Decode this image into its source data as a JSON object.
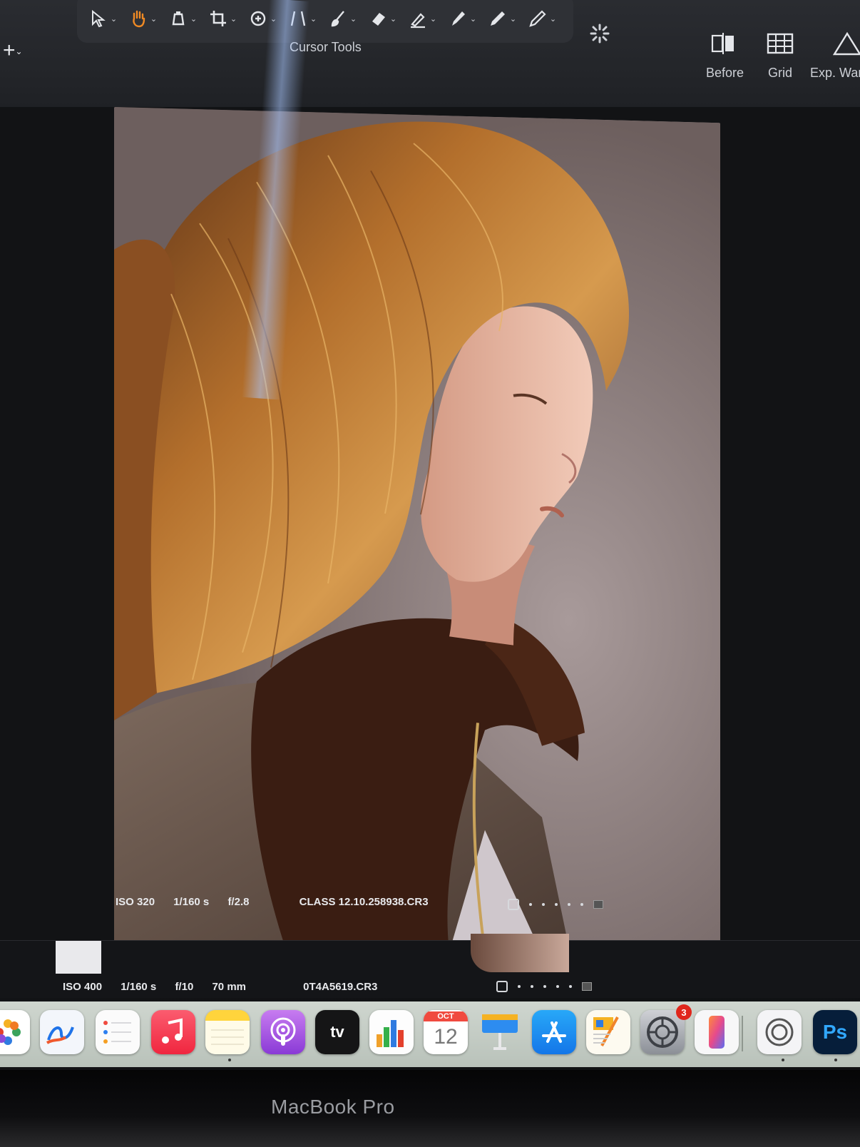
{
  "toolbar": {
    "tools": [
      {
        "name": "pointer-icon"
      },
      {
        "name": "pan-icon",
        "active": true
      },
      {
        "name": "loupe-icon"
      },
      {
        "name": "crop-icon"
      },
      {
        "name": "rotate-icon"
      },
      {
        "name": "keystone-icon"
      },
      {
        "name": "brush-icon"
      },
      {
        "name": "eraser-icon"
      },
      {
        "name": "gradient-icon"
      },
      {
        "name": "eyedropper-icon"
      },
      {
        "name": "picker-icon"
      },
      {
        "name": "annotation-icon"
      }
    ],
    "group_label": "Cursor Tools",
    "accent_color": "#f08a24",
    "view_buttons": {
      "before": "Before",
      "grid": "Grid",
      "exposure_warning": "Exp. War"
    }
  },
  "main_image": {
    "iso": "ISO 320",
    "shutter": "1/160 s",
    "aperture": "f/2.8",
    "filename": "CLASS 12.10.258938.CR3"
  },
  "filmstrip": {
    "iso": "ISO 400",
    "shutter": "1/160 s",
    "aperture": "f/10",
    "focal_length": "70 mm",
    "filename": "0T4A5619.CR3"
  },
  "dock": {
    "apps": [
      {
        "name": "photos-app"
      },
      {
        "name": "freeform-app"
      },
      {
        "name": "reminders-app"
      },
      {
        "name": "music-app"
      },
      {
        "name": "notes-app"
      },
      {
        "name": "podcasts-app"
      },
      {
        "name": "apple-tv-app",
        "label": "tv"
      },
      {
        "name": "numbers-app"
      },
      {
        "name": "calendar-app",
        "month": "OCT",
        "day": "12"
      },
      {
        "name": "keynote-app"
      },
      {
        "name": "app-store-app"
      },
      {
        "name": "pages-app"
      },
      {
        "name": "system-settings-app",
        "badge": "3"
      },
      {
        "name": "iphone-mirroring-app"
      },
      {
        "name": "capture-one-app"
      },
      {
        "name": "photoshop-app",
        "label": "Ps"
      }
    ]
  },
  "device_label": "MacBook Pro"
}
